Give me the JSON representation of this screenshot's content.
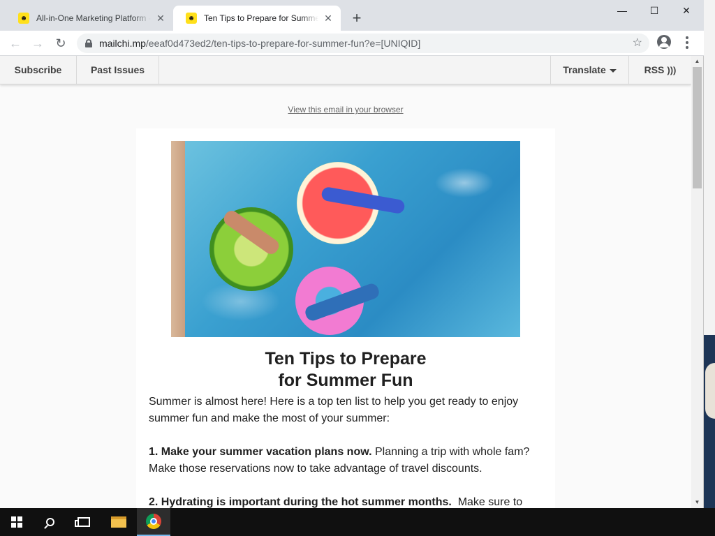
{
  "browser": {
    "tabs": [
      {
        "title": "All-in-One Marketing Platform - M",
        "active": false
      },
      {
        "title": "Ten Tips to Prepare for Summer F",
        "active": true
      }
    ],
    "new_tab": "+",
    "url_host": "mailchi.mp",
    "url_path": "/eeaf0d473ed2/ten-tips-to-prepare-for-summer-fun?e=[UNIQID]",
    "window_controls": {
      "minimize": "—",
      "maximize": "☐",
      "close": "✕"
    }
  },
  "mailchimp_bar": {
    "subscribe": "Subscribe",
    "past_issues": "Past Issues",
    "translate": "Translate",
    "rss": "RSS"
  },
  "email": {
    "view_in_browser": "View this email in your browser",
    "headline_line1": "Ten Tips to Prepare",
    "headline_line2": "for Summer Fun",
    "intro": "Summer is almost here! Here is a top ten list to help you get ready to enjoy summer fun and make the most of your summer:",
    "tip1_bold": "1. Make your summer vacation plans now.",
    "tip1_text": " Planning a trip with whole fam? Make those reservations now to take advantage of travel discounts.",
    "tip2_bold": "2. Hydrating is important during the hot summer months.",
    "tip2_text": "  Make sure to"
  },
  "icons": {
    "back": "back-arrow-icon",
    "forward": "forward-arrow-icon",
    "reload": "reload-icon",
    "lock": "lock-icon",
    "star": "star-icon",
    "profile": "profile-icon",
    "menu": "kebab-menu-icon",
    "rss": "rss-icon"
  },
  "colors": {
    "tabstrip": "#dee1e6",
    "mc_bar": "#f4f4f4",
    "page_bg": "#fafafa",
    "taskbar": "#101010"
  }
}
